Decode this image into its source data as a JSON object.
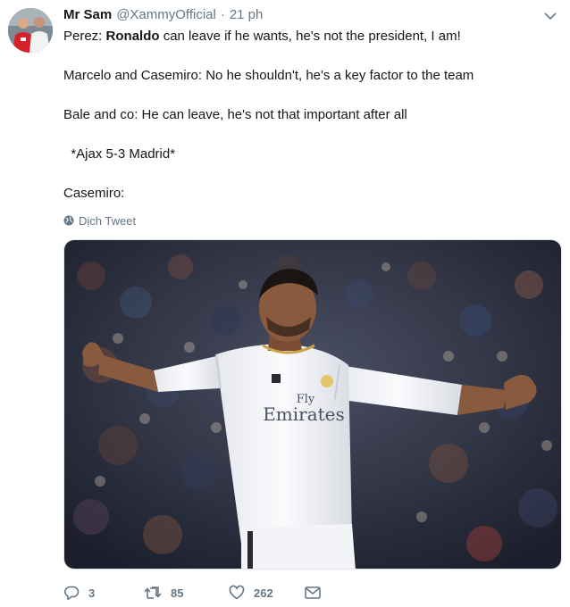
{
  "tweet": {
    "display_name": "Mr Sam",
    "handle": "@XammyOfficial",
    "separator": "·",
    "time": "21 ph",
    "lines": [
      {
        "prefix": "Perez: ",
        "bold": "Ronaldo",
        "rest": " can leave if he wants, he's not the president, I am!"
      },
      {
        "prefix": "",
        "bold": "",
        "rest": ""
      },
      {
        "prefix": "Marcelo and Casemiro: No he shouldn't, he's a key factor to the team",
        "bold": "",
        "rest": ""
      },
      {
        "prefix": "",
        "bold": "",
        "rest": ""
      },
      {
        "prefix": "Bale and co: He can leave, he's not that important after all",
        "bold": "",
        "rest": ""
      },
      {
        "prefix": "",
        "bold": "",
        "rest": ""
      },
      {
        "prefix": "  *Ajax 5-3 Madrid*",
        "bold": "",
        "rest": ""
      },
      {
        "prefix": "",
        "bold": "",
        "rest": ""
      },
      {
        "prefix": "Casemiro:",
        "bold": "",
        "rest": ""
      }
    ],
    "translate_label": "Dịch Tweet",
    "jersey_sponsor_line1": "Fly",
    "jersey_sponsor_line2": "Emirates"
  },
  "actions": {
    "reply_count": "3",
    "retweet_count": "85",
    "like_count": "262"
  },
  "icons": {
    "caret": "chevron-down-icon",
    "globe": "globe-icon",
    "reply": "reply-icon",
    "retweet": "retweet-icon",
    "like": "heart-icon",
    "message": "envelope-icon"
  }
}
